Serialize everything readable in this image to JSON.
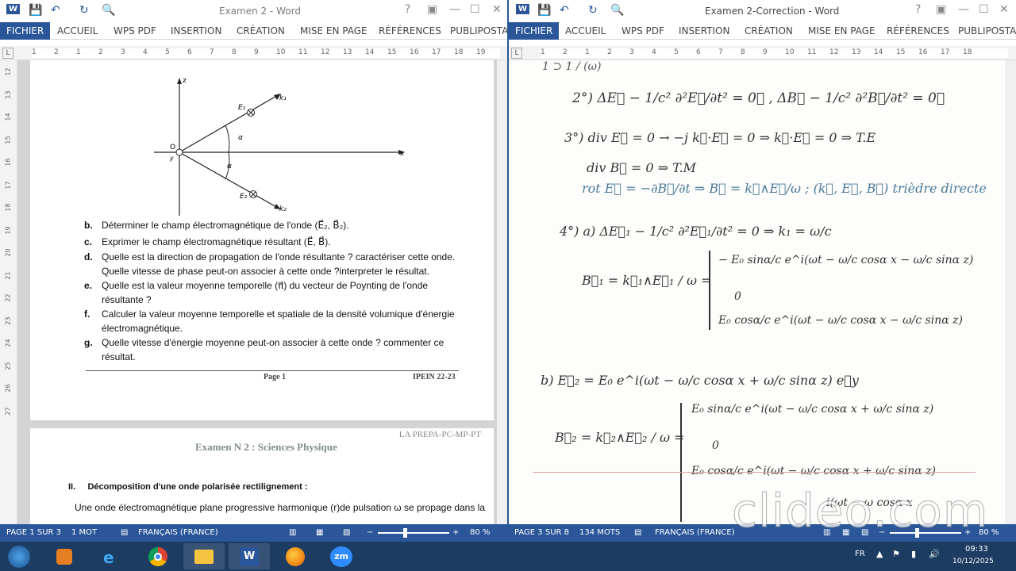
{
  "left_window": {
    "title": "Examen 2 - Word",
    "tabs": [
      "FICHIER",
      "ACCUEIL",
      "WPS PDF",
      "INSERTION",
      "CRÉATION",
      "MISE EN PAGE",
      "RÉFÉRENCES",
      "PUBLIPOSTA"
    ],
    "status": {
      "page": "PAGE 1 SUR 3",
      "words": "1 MOT",
      "language": "FRANÇAIS (FRANCE)",
      "zoom": "80 %"
    },
    "ruler_numbers": [
      "1",
      "2",
      "1",
      "2",
      "3",
      "4",
      "5",
      "6",
      "7",
      "8",
      "9",
      "10",
      "11",
      "12",
      "13",
      "14",
      "15",
      "16",
      "17",
      "18",
      "19"
    ],
    "vruler_numbers": [
      "12",
      "13",
      "14",
      "15",
      "16",
      "17",
      "18",
      "19",
      "20",
      "21",
      "22",
      "23",
      "24",
      "25",
      "26",
      "27"
    ],
    "figure": {
      "z": "z",
      "x": "x",
      "y": "y",
      "o": "O",
      "k1": "k₁",
      "k2": "k₂",
      "e1": "E₁",
      "e2": "E₂",
      "alpha1": "α",
      "alpha2": "α"
    },
    "questions": [
      {
        "letter": "b.",
        "text": "Déterminer le champ électromagnétique de l'onde (E⃗₂, B⃗₂)."
      },
      {
        "letter": "c.",
        "text": "Exprimer le champ électromagnétique résultant (E⃗, B⃗)."
      },
      {
        "letter": "d.",
        "text": "Quelle est la direction de propagation de l'onde résultante ? caractériser cette onde."
      },
      {
        "letter": "",
        "text": "Quelle vitesse de phase peut-on associer à cette onde ?interpreter le résultat."
      },
      {
        "letter": "e.",
        "text": "Quelle est la valeur moyenne temporelle (π⃗) du vecteur de Poynting de l'onde"
      },
      {
        "letter": "",
        "text": "résultante ?"
      },
      {
        "letter": "f.",
        "text": "Calculer la valeur moyenne temporelle et spatiale de la densité volumique d'énergie"
      },
      {
        "letter": "",
        "text": "électromagnétique."
      },
      {
        "letter": "g.",
        "text": "Quelle vitesse d'énergie moyenne peut-on associer à cette onde ? commenter ce"
      },
      {
        "letter": "",
        "text": "résultat."
      }
    ],
    "footer": {
      "page": "Page 1",
      "code": "IPEIN 22-23"
    },
    "page2": {
      "header": "LA PREPA-PC-MP-PT",
      "title": "Examen N 2 : Sciences Physique",
      "section": "II.     Décomposition d'une onde polarisée rectilignement :",
      "text": "Une onde électromagnétique plane progressive harmonique (r)de pulsation ω se propage dans la"
    }
  },
  "right_window": {
    "title": "Examen 2-Correction - Word",
    "tabs": [
      "FICHIER",
      "ACCUEIL",
      "WPS PDF",
      "INSERTION",
      "CRÉATION",
      "MISE EN PAGE",
      "RÉFÉRENCES",
      "PUBLIPOSTA"
    ],
    "status": {
      "page": "PAGE 3 SUR 8",
      "words": "134 MOTS",
      "language": "FRANÇAIS (FRANCE)",
      "zoom": "80 %"
    },
    "ruler_numbers": [
      "1",
      "2",
      "1",
      "2",
      "3",
      "4",
      "5",
      "6",
      "7",
      "8",
      "9",
      "10",
      "11",
      "12",
      "13",
      "14",
      "15",
      "16",
      "17",
      "18"
    ],
    "handwriting": [
      "2°) ΔE⃗ − 1/c² ∂²E⃗/∂t² = 0⃗ ,  ΔB⃗ − 1/c² ∂²B⃗/∂t² = 0⃗",
      "3°) div E⃗ = 0  → −j k⃗·E⃗ = 0  ⇒ k⃗·E⃗ = 0 ⇒ T.E",
      "div B⃗ = 0  ⇒ T.M",
      "rot E⃗ = −∂B⃗/∂t  ⇒ B⃗ = k⃗∧E⃗/ω ; (k⃗, E⃗, B⃗) trièdre directe",
      "4°) a) ΔE⃗₁ − 1/c² ∂²E⃗₁/∂t² = 0 ⇒ k₁ = ω/c",
      "B⃗₁ = k⃗₁∧E⃗₁ / ω  =",
      "− E₀ sinα/c   e^i(ωt − ω/c cosα x − ω/c sinα z)",
      "0",
      "E₀ cosα/c   e^i(ωt − ω/c cosα x − ω/c sinα z)",
      "b) E⃗₂ = E₀ e^i(ωt − ω/c cosα x + ω/c sinα z) e⃗y",
      "B⃗₂ = k⃗₂∧E⃗₂ / ω  =",
      "E₀ sinα/c   e^i(ωt − ω/c cosα x + ω/c sinα z)",
      "0",
      "E₀ cosα/c   e^i(ωt − ω/c cosα x + ω/c sinα z)",
      "i(ωt − ω cosα x"
    ]
  },
  "taskbar": {
    "lang": "FR",
    "time": "09:33",
    "date": "10/12/2025",
    "apps": [
      "start",
      "media-player",
      "internet-explorer",
      "chrome",
      "file-explorer",
      "word",
      "firefox",
      "zoom"
    ],
    "zoom_label": "zm"
  },
  "watermark": "clideo.com"
}
